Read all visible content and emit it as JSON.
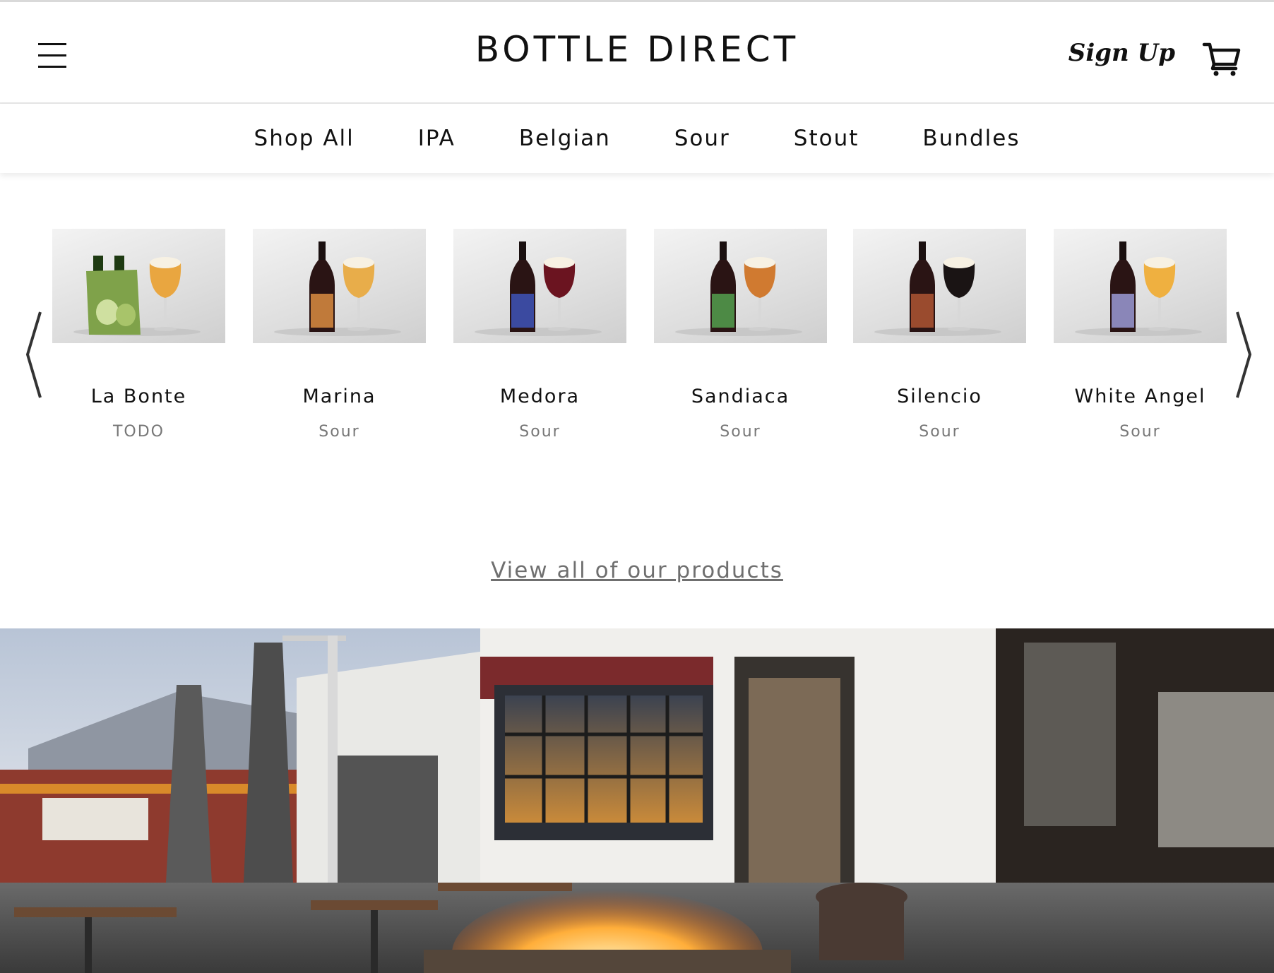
{
  "header": {
    "logo": "BOTTLE DIRECT",
    "signup_label": "Sign Up",
    "menu_icon": "hamburger-icon",
    "cart_icon": "cart-icon"
  },
  "categories": [
    "Shop All",
    "IPA",
    "Belgian",
    "Sour",
    "Stout",
    "Bundles"
  ],
  "carousel": {
    "prev_icon": "chevron-left-icon",
    "next_icon": "chevron-right-icon",
    "products": [
      {
        "name": "La Bonte",
        "style": "TODO",
        "bottle": "four-pack",
        "bottle_label": "#7fa24a",
        "beer": "#e9a640"
      },
      {
        "name": "Marina",
        "style": "Sour",
        "bottle": "single",
        "bottle_label": "#c07a3a",
        "beer": "#e8ad4a"
      },
      {
        "name": "Medora",
        "style": "Sour",
        "bottle": "single",
        "bottle_label": "#3b4aa0",
        "beer": "#6b1420"
      },
      {
        "name": "Sandiaca",
        "style": "Sour",
        "bottle": "single",
        "bottle_label": "#4d8a45",
        "beer": "#d07a30"
      },
      {
        "name": "Silencio",
        "style": "Sour",
        "bottle": "single",
        "bottle_label": "#9a4b2e",
        "beer": "#1a1414"
      },
      {
        "name": "White Angel",
        "style": "Sour",
        "bottle": "single",
        "bottle_label": "#8a86b8",
        "beer": "#efb040"
      }
    ]
  },
  "view_all_label": "View all of our products",
  "colors": {
    "text": "#111111",
    "muted": "#777777",
    "link": "#6f6f6f",
    "divider": "#e6e6e6"
  }
}
